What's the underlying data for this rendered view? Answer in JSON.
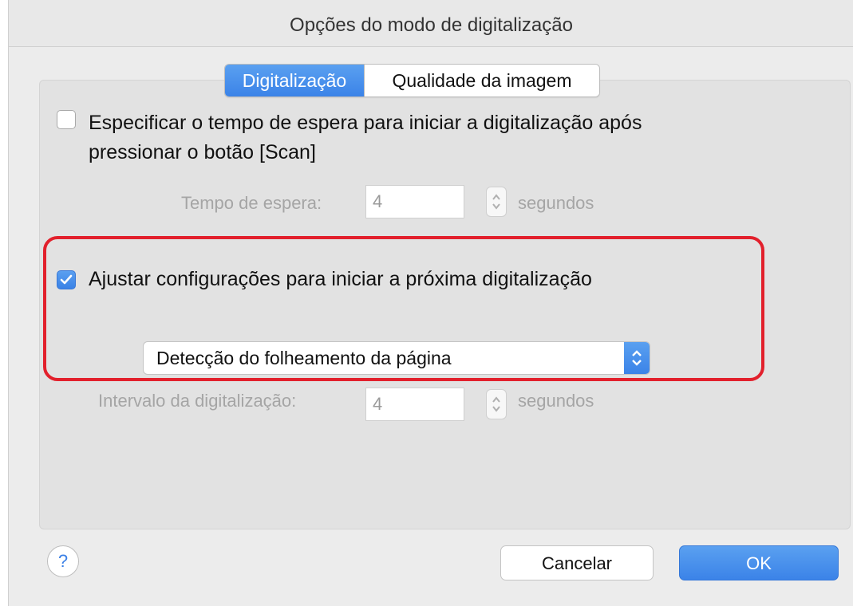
{
  "window": {
    "title": "Opções do modo de digitalização"
  },
  "tabs": [
    {
      "label": "Digitalização",
      "active": true
    },
    {
      "label": "Qualidade da imagem",
      "active": false
    }
  ],
  "wait_option": {
    "checked": false,
    "label_line1": "Especificar o tempo de espera para iniciar a digitalização após",
    "label_line2": "pressionar o botão [Scan]",
    "wait_label": "Tempo de espera:",
    "wait_value": "4",
    "unit": "segundos"
  },
  "next_scan_option": {
    "checked": true,
    "label": "Ajustar configurações para iniciar a próxima digitalização",
    "mode_selected": "Detecção do folheamento da página",
    "interval_label": "Intervalo da digitalização:",
    "interval_value": "4",
    "unit": "segundos"
  },
  "footer": {
    "help_label": "?",
    "cancel_label": "Cancelar",
    "ok_label": "OK"
  },
  "colors": {
    "accent": "#3b83e8",
    "highlight": "#e2202c",
    "disabled_text": "#a5a5a5"
  }
}
